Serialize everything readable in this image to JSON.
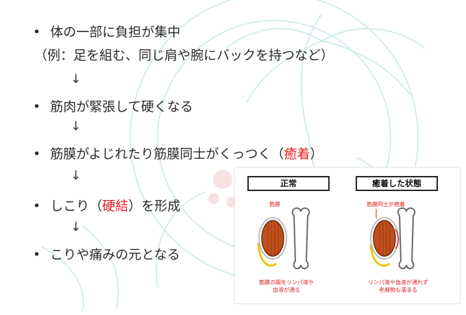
{
  "steps": {
    "s1": "体の一部に負担が集中",
    "s1_example": "（例：足を組む、同じ肩や腕にバックを持つなど）",
    "s2": "筋肉が緊張して硬くなる",
    "s3_pre": "筋膜がよじれたり筋膜同士がくっつく（",
    "s3_red": "癒着",
    "s3_post": "）",
    "s4_pre": "しこり（",
    "s4_red": "硬結",
    "s4_post": "）を形成",
    "s5": "こりや痛みの元となる",
    "arrow": "↓"
  },
  "figure": {
    "left_header": "正常",
    "right_header": "癒着した状態",
    "left_label_top": "筋膜",
    "right_label_top": "筋膜同士が癒着",
    "left_caption_1": "筋膜の間をリンパ液や",
    "left_caption_2": "血液が通る",
    "right_caption_1": "リンパ液や血液が通れず",
    "right_caption_2": "老廃物も溜まる"
  },
  "colors": {
    "accent_red": "#e02020",
    "muscle": "#c0501c",
    "watermark": "#cfeaea"
  }
}
